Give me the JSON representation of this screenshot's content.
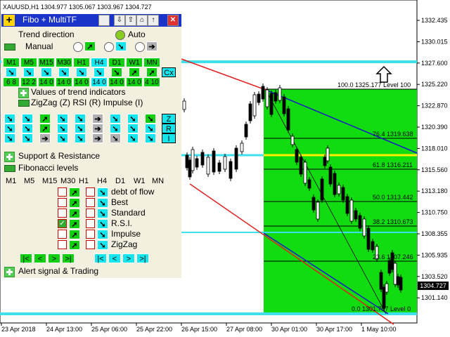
{
  "symbol_header": "XAUUSD,H1  1304.977 1305.067 1303.967 1304.727",
  "price_tag": "1304.727",
  "price_axis": [
    "1332.435",
    "1330.015",
    "1327.600",
    "1325.220",
    "1322.870",
    "1320.390",
    "1318.010",
    "1315.560",
    "1313.180",
    "1310.750",
    "1308.355",
    "1305.935",
    "1303.520",
    "1301.140"
  ],
  "time_axis": [
    "23 Apr 2018",
    "24 Apr 13:00",
    "25 Apr 06:00",
    "25 Apr 22:00",
    "26 Apr 15:00",
    "27 Apr 08:00",
    "30 Apr 01:00",
    "30 Apr 17:00",
    "1 May 10:00"
  ],
  "fibo_levels": [
    "100.0  1325.177 Level 100",
    "76.4  1319.638",
    "61.8  1316.211",
    "50.0  1313.442",
    "38.2  1310.673",
    "23.6  1307.246",
    "0.0  1301.707 Level 0"
  ],
  "panel": {
    "title": "Fibo + MultiTF",
    "trend_direction": "Trend direction",
    "auto": "Auto",
    "manual": "Manual",
    "tf_labels": [
      "M1",
      "M5",
      "M15",
      "M30",
      "H1",
      "H4",
      "D1",
      "W1",
      "MN"
    ],
    "tf_periods": [
      "6 8",
      "12 2",
      "14 0",
      "14 0",
      "14 0",
      "14 0",
      "14 0",
      "14 0",
      "4 10"
    ],
    "cx": "Cx",
    "values_title": "Values of trend indicators",
    "values_sub": "ZigZag (Z)  RSI (R)  Impulse (I)",
    "z": "Z",
    "r": "R",
    "i": "I",
    "support": "Support & Resistance",
    "fib_levels_title": "Fibonacci levels",
    "fib_tf": [
      "M1",
      "M5",
      "M15",
      "M30",
      "H1",
      "H4",
      "D1",
      "W1",
      "MN"
    ],
    "fib_items": [
      "debt of flow",
      "Best",
      "Standard",
      "R.S.I.",
      "Impulse",
      "ZigZag"
    ],
    "nav": [
      "|<",
      "<",
      ">",
      ">|"
    ],
    "alert": "Alert signal & Trading"
  },
  "colors": {
    "fibo_zone": "#10dc10",
    "trend_up": "#1a1ac8",
    "trend_down": "#e02020",
    "level_cyan": "#3ee0ee",
    "level_yellow": "#ffee00"
  }
}
